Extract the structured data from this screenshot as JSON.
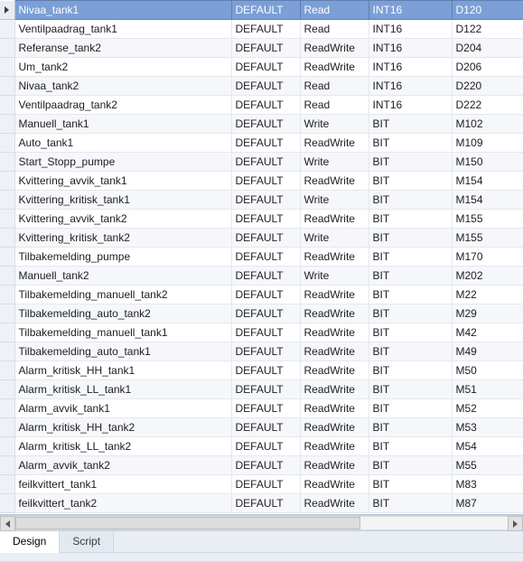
{
  "selected_row_marker": "row-marker",
  "table": {
    "selected": {
      "name": "Nivaa_tank1",
      "col2": "DEFAULT",
      "col3": "Read",
      "col4": "INT16",
      "col5": "D120"
    },
    "rows": [
      {
        "name": "Ventilpaadrag_tank1",
        "col2": "DEFAULT",
        "col3": "Read",
        "col4": "INT16",
        "col5": "D122"
      },
      {
        "name": "Referanse_tank2",
        "col2": "DEFAULT",
        "col3": "ReadWrite",
        "col4": "INT16",
        "col5": "D204"
      },
      {
        "name": "Um_tank2",
        "col2": "DEFAULT",
        "col3": "ReadWrite",
        "col4": "INT16",
        "col5": "D206"
      },
      {
        "name": "Nivaa_tank2",
        "col2": "DEFAULT",
        "col3": "Read",
        "col4": "INT16",
        "col5": "D220"
      },
      {
        "name": "Ventilpaadrag_tank2",
        "col2": "DEFAULT",
        "col3": "Read",
        "col4": "INT16",
        "col5": "D222"
      },
      {
        "name": "Manuell_tank1",
        "col2": "DEFAULT",
        "col3": "Write",
        "col4": "BIT",
        "col5": "M102"
      },
      {
        "name": "Auto_tank1",
        "col2": "DEFAULT",
        "col3": "ReadWrite",
        "col4": "BIT",
        "col5": "M109"
      },
      {
        "name": "Start_Stopp_pumpe",
        "col2": "DEFAULT",
        "col3": "Write",
        "col4": "BIT",
        "col5": "M150"
      },
      {
        "name": "Kvittering_avvik_tank1",
        "col2": "DEFAULT",
        "col3": "ReadWrite",
        "col4": "BIT",
        "col5": "M154"
      },
      {
        "name": "Kvittering_kritisk_tank1",
        "col2": "DEFAULT",
        "col3": "Write",
        "col4": "BIT",
        "col5": "M154"
      },
      {
        "name": "Kvittering_avvik_tank2",
        "col2": "DEFAULT",
        "col3": "ReadWrite",
        "col4": "BIT",
        "col5": "M155"
      },
      {
        "name": "Kvittering_kritisk_tank2",
        "col2": "DEFAULT",
        "col3": "Write",
        "col4": "BIT",
        "col5": "M155"
      },
      {
        "name": "Tilbakemelding_pumpe",
        "col2": "DEFAULT",
        "col3": "ReadWrite",
        "col4": "BIT",
        "col5": "M170"
      },
      {
        "name": "Manuell_tank2",
        "col2": "DEFAULT",
        "col3": "Write",
        "col4": "BIT",
        "col5": "M202"
      },
      {
        "name": "Tilbakemelding_manuell_tank2",
        "col2": "DEFAULT",
        "col3": "ReadWrite",
        "col4": "BIT",
        "col5": "M22"
      },
      {
        "name": "Tilbakemelding_auto_tank2",
        "col2": "DEFAULT",
        "col3": "ReadWrite",
        "col4": "BIT",
        "col5": "M29"
      },
      {
        "name": "Tilbakemelding_manuell_tank1",
        "col2": "DEFAULT",
        "col3": "ReadWrite",
        "col4": "BIT",
        "col5": "M42"
      },
      {
        "name": "Tilbakemelding_auto_tank1",
        "col2": "DEFAULT",
        "col3": "ReadWrite",
        "col4": "BIT",
        "col5": "M49"
      },
      {
        "name": "Alarm_kritisk_HH_tank1",
        "col2": "DEFAULT",
        "col3": "ReadWrite",
        "col4": "BIT",
        "col5": "M50"
      },
      {
        "name": "Alarm_kritisk_LL_tank1",
        "col2": "DEFAULT",
        "col3": "ReadWrite",
        "col4": "BIT",
        "col5": "M51"
      },
      {
        "name": "Alarm_avvik_tank1",
        "col2": "DEFAULT",
        "col3": "ReadWrite",
        "col4": "BIT",
        "col5": "M52"
      },
      {
        "name": "Alarm_kritisk_HH_tank2",
        "col2": "DEFAULT",
        "col3": "ReadWrite",
        "col4": "BIT",
        "col5": "M53"
      },
      {
        "name": "Alarm_kritisk_LL_tank2",
        "col2": "DEFAULT",
        "col3": "ReadWrite",
        "col4": "BIT",
        "col5": "M54"
      },
      {
        "name": "Alarm_avvik_tank2",
        "col2": "DEFAULT",
        "col3": "ReadWrite",
        "col4": "BIT",
        "col5": "M55"
      },
      {
        "name": "feilkvittert_tank1",
        "col2": "DEFAULT",
        "col3": "ReadWrite",
        "col4": "BIT",
        "col5": "M83"
      },
      {
        "name": "feilkvittert_tank2",
        "col2": "DEFAULT",
        "col3": "ReadWrite",
        "col4": "BIT",
        "col5": "M87"
      }
    ]
  },
  "tabs": {
    "design": "Design",
    "script": "Script"
  }
}
